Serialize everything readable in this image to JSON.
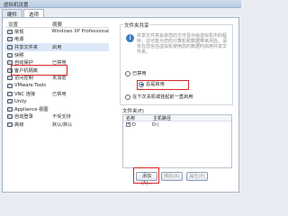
{
  "window": {
    "title": "虚拟机设置"
  },
  "tabs": [
    {
      "label": "硬件",
      "active": false
    },
    {
      "label": "选项",
      "active": true
    }
  ],
  "device_list": {
    "headers": {
      "setting": "设置",
      "summary": "摘要"
    },
    "items": [
      {
        "name": "常规",
        "summary": "Windows XP Professional",
        "icon": "general-icon",
        "selected": false
      },
      {
        "name": "电源",
        "summary": "",
        "icon": "power-icon",
        "selected": false
      },
      {
        "name": "共享文件夹",
        "summary": "启用",
        "icon": "shared-folders-icon",
        "selected": true
      },
      {
        "name": "快照",
        "summary": "",
        "icon": "snapshot-icon",
        "selected": false
      },
      {
        "name": "自动保护",
        "summary": "已禁用",
        "icon": "autoprotect-icon",
        "selected": false
      },
      {
        "name": "客户机隔离",
        "summary": "",
        "icon": "isolation-icon",
        "selected": false
      },
      {
        "name": "访问控制",
        "summary": "未加密",
        "icon": "lock-icon",
        "selected": false
      },
      {
        "name": "VMware Tools",
        "summary": "",
        "icon": "vmware-tools-icon",
        "selected": false
      },
      {
        "name": "VNC 连接",
        "summary": "已禁用",
        "icon": "vnc-icon",
        "selected": false
      },
      {
        "name": "Unity",
        "summary": "",
        "icon": "unity-icon",
        "selected": false
      },
      {
        "name": "Appliance 视图",
        "summary": "",
        "icon": "appliance-icon",
        "selected": false
      },
      {
        "name": "自动登录",
        "summary": "不受支持",
        "icon": "autologin-icon",
        "selected": false
      },
      {
        "name": "高级",
        "summary": "默认/默认",
        "icon": "advanced-icon",
        "selected": false
      }
    ]
  },
  "shared_folders": {
    "title": "文件夹共享",
    "description": "共享文件夹会将您的文件显示给虚拟机中的程序。这可能为您的计算机和数据带来风险。请仅在您信任虚拟机使用您的数据时启用共享文件夹。",
    "options": [
      {
        "label": "已禁用",
        "checked": false
      },
      {
        "label": "总是启用",
        "checked": true
      },
      {
        "label": "在下次关机或挂起前一直启用",
        "checked": false
      }
    ]
  },
  "folders": {
    "title": "文件夹(F)",
    "headers": {
      "name": "名称",
      "host_path": "主机路径"
    },
    "rows": [
      {
        "name": "D",
        "host_path": "D:\\"
      }
    ],
    "buttons": {
      "add": "添加(A)...",
      "remove": "移除(R)",
      "properties": "属性(P)"
    }
  },
  "watermark": "Baidu 经验"
}
